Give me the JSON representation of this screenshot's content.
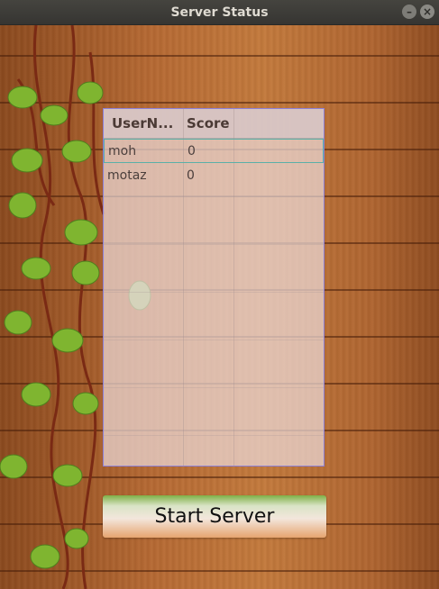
{
  "window": {
    "title": "Server Status"
  },
  "table": {
    "columns": [
      "UserN...",
      "Score"
    ],
    "rows": [
      {
        "user": "moh",
        "score": "0",
        "selected": true
      },
      {
        "user": "motaz",
        "score": "0",
        "selected": false
      }
    ]
  },
  "button": {
    "label": "Start Server"
  },
  "colors": {
    "wood": "#b76a33",
    "selection": "#5ab0a8",
    "table_border": "#8c7fd6"
  },
  "icons": {
    "minimize": "minimize-icon",
    "close": "close-icon"
  }
}
